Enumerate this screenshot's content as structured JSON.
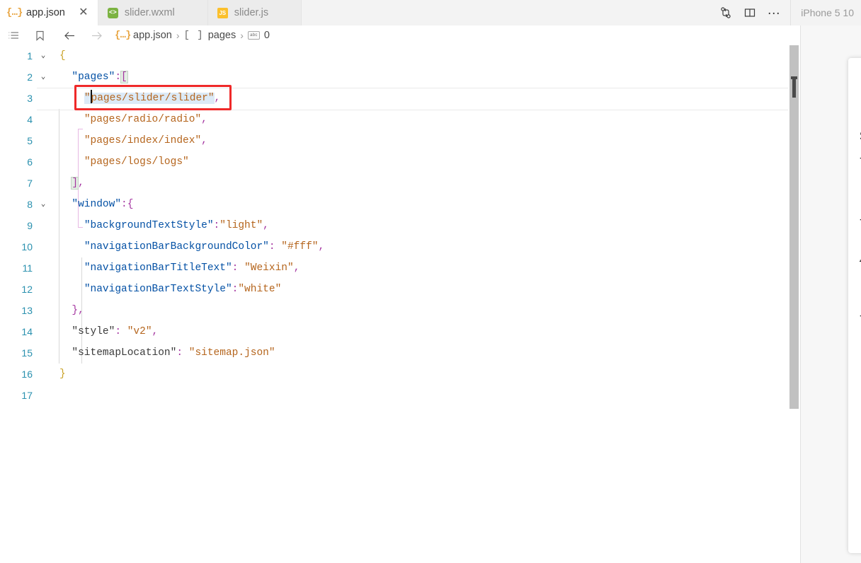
{
  "window": {
    "device_label": "iPhone 5 10"
  },
  "tabs": [
    {
      "label": "app.json",
      "icon": "json-file-icon",
      "icon_text": "{…}",
      "active": true,
      "close_label": "✕"
    },
    {
      "label": "slider.wxml",
      "icon": "wxml-file-icon",
      "icon_text": "<>",
      "active": false,
      "close_label": "✕"
    },
    {
      "label": "slider.js",
      "icon": "js-file-icon",
      "icon_text": "JS",
      "active": false,
      "close_label": "✕"
    }
  ],
  "tab_actions": [
    {
      "name": "compare-changes-icon",
      "title": "Compare Changes"
    },
    {
      "name": "split-editor-icon",
      "title": "Split Editor"
    },
    {
      "name": "more-actions-icon",
      "title": "More Actions...",
      "glyph": "…"
    }
  ],
  "breadcrumb": {
    "outline_icon": "outline-list-icon",
    "bookmark_icon": "bookmark-icon",
    "back_icon": "back-arrow-icon",
    "forward_icon": "forward-arrow-icon",
    "segments": [
      {
        "icon": "json-file-icon",
        "icon_text": "{…}",
        "label": "app.json"
      },
      {
        "icon": "array-type-icon",
        "icon_text": "[ ]",
        "label": "pages"
      },
      {
        "icon": "string-type-icon",
        "icon_text": "abc",
        "label": "0"
      }
    ],
    "separator": "›"
  },
  "editor": {
    "language": "json",
    "file": "app.json",
    "cursor_line": 3,
    "selected_text": "\"pages/slider/slider\"",
    "annotation": {
      "type": "red-rectangle",
      "target_line": 3
    },
    "lines": [
      {
        "num": "1",
        "fold": "⌄",
        "text": "{"
      },
      {
        "num": "2",
        "fold": "⌄",
        "text": "  \"pages\":["
      },
      {
        "num": "3",
        "fold": "",
        "text": "    \"pages/slider/slider\","
      },
      {
        "num": "4",
        "fold": "",
        "text": "    \"pages/radio/radio\","
      },
      {
        "num": "5",
        "fold": "",
        "text": "    \"pages/index/index\","
      },
      {
        "num": "6",
        "fold": "",
        "text": "    \"pages/logs/logs\""
      },
      {
        "num": "7",
        "fold": "",
        "text": "  ],"
      },
      {
        "num": "8",
        "fold": "⌄",
        "text": "  \"window\":{"
      },
      {
        "num": "9",
        "fold": "",
        "text": "    \"backgroundTextStyle\":\"light\","
      },
      {
        "num": "10",
        "fold": "",
        "text": "    \"navigationBarBackgroundColor\": \"#fff\","
      },
      {
        "num": "11",
        "fold": "",
        "text": "    \"navigationBarTitleText\": \"Weixin\","
      },
      {
        "num": "12",
        "fold": "",
        "text": "    \"navigationBarTextStyle\":\"white\""
      },
      {
        "num": "13",
        "fold": "",
        "text": "  },"
      },
      {
        "num": "14",
        "fold": "",
        "text": "  \"style\": \"v2\","
      },
      {
        "num": "15",
        "fold": "",
        "text": "  \"sitemapLocation\": \"sitemap.json\""
      },
      {
        "num": "16",
        "fold": "",
        "text": "}"
      },
      {
        "num": "17",
        "fold": "",
        "text": ""
      }
    ]
  },
  "simulator": {
    "page_title": "slider",
    "rows": [
      {
        "label": "设置",
        "control": "circle"
      },
      {
        "label": "设置",
        "control": "none"
      },
      {
        "label": "显示",
        "control": "circle",
        "underline": true
      },
      {
        "label": "设置",
        "control": "circle"
      }
    ]
  },
  "colors": {
    "accent_json": "#e8a33d",
    "key_blue": "#0451a5",
    "string_orange": "#b5651d",
    "punct_purple": "#a435a0",
    "annotation_red": "#ef2929",
    "selection_blue": "#dceaf7",
    "tab_inactive_bg": "#ececec",
    "tab_active_bg": "#ffffff"
  }
}
